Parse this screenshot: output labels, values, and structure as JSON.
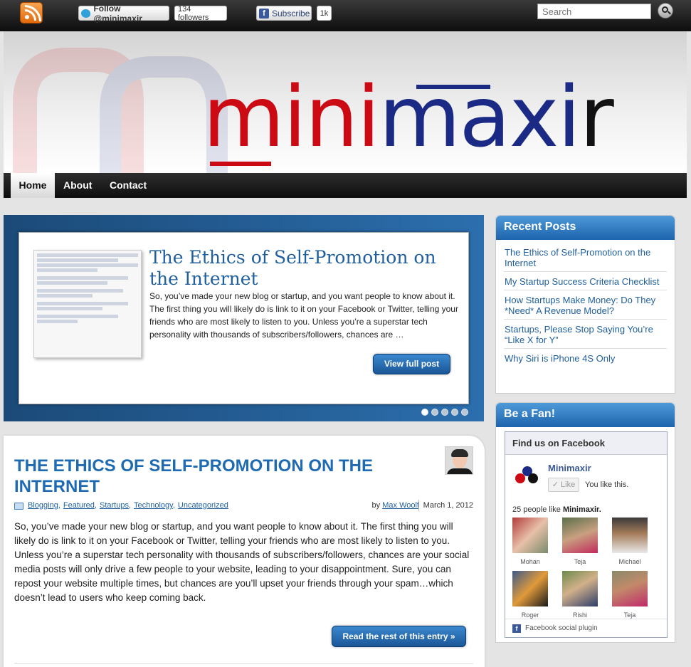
{
  "topbar": {
    "twitter_follow": "Follow @minimaxir",
    "twitter_followers": "134 followers",
    "facebook_subscribe": "Subscribe",
    "facebook_count": "1k",
    "search_placeholder": "Search"
  },
  "site": {
    "logo_mini": "mini",
    "logo_maxi": "maxi",
    "logo_r": "r"
  },
  "nav": {
    "items": [
      {
        "label": "Home"
      },
      {
        "label": "About"
      },
      {
        "label": "Contact"
      }
    ]
  },
  "slider": {
    "title": "The Ethics of Self-Promotion on the Internet",
    "excerpt": "So, you’ve made your new blog or startup, and you want people to know about it. The first thing you will likely do is link to it on your Facebook or Twitter, telling your friends who are most likely to listen to you. Unless you’re a superstar tech personality with thousands of subscribers/followers, chances are …",
    "button": "View full post",
    "dots": 5,
    "active_dot": 1
  },
  "post": {
    "title": "The Ethics of Self-Promotion on the Internet",
    "categories": [
      "Blogging",
      "Featured",
      "Startups",
      "Technology",
      "Uncategorized"
    ],
    "by_prefix": "by",
    "author": "Max Woolf",
    "date": "March 1, 2012",
    "body": "So, you’ve made your new blog or startup, and you want people to know about it. The first thing you will likely do is link to it on your Facebook or Twitter, telling your friends who are most likely to listen to you. Unless you’re a superstar tech personality with thousands of subscribers/followers, chances are your social media posts will only drive a few people to your website, leading to your disappointment. Sure, you can repost your website multiple times, but chances are you’ll upset your friends through your spam…which doesn’t lead to users who keep coming back.",
    "read_more": "Read the rest of this entry »"
  },
  "recent_posts": {
    "title": "Recent Posts",
    "items": [
      {
        "label": "The Ethics of Self-Promotion on the Internet"
      },
      {
        "label": "My Startup Success Criteria Checklist"
      },
      {
        "label": "How Startups Make Money: Do They *Need* A Revenue Model?"
      },
      {
        "label": "Startups, Please Stop Saying You’re “Like X for Y”"
      },
      {
        "label": "Why Siri is iPhone 4S Only"
      }
    ]
  },
  "fan_box": {
    "title": "Be a Fan!",
    "header": "Find us on Facebook",
    "page_name": "Minimaxir",
    "like_button": "Like",
    "you_like": "You like this.",
    "people_like_prefix": "25 people like",
    "people_like_name": "Minimaxir.",
    "faces": [
      {
        "name": "Mohan"
      },
      {
        "name": "Teja"
      },
      {
        "name": "Michael"
      },
      {
        "name": "Roger"
      },
      {
        "name": "Rishi"
      },
      {
        "name": "Teja"
      }
    ],
    "footer": "Facebook social plugin"
  }
}
